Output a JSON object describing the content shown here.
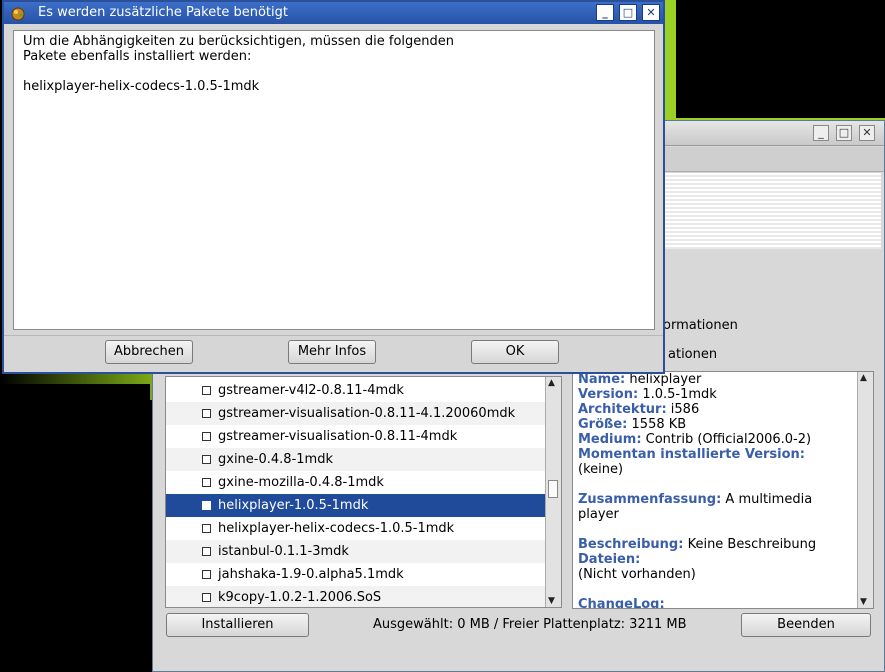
{
  "dialog": {
    "title": "Es werden zusätzliche Pakete benötigt",
    "message": "Um die Abhängigkeiten zu berücksichtigen, müssen die folgenden\nPakete ebenfalls installiert werden:\n\nhelixplayer-helix-codecs-1.0.5-1mdk",
    "buttons": {
      "cancel": "Abbrechen",
      "more_info": "Mehr Infos",
      "ok": "OK"
    },
    "controls": {
      "minimize": "_",
      "maximize": "□",
      "close": "✕"
    }
  },
  "main_window": {
    "controls": {
      "minimize": "_",
      "maximize": "□",
      "close": "✕"
    },
    "partial_labels": {
      "label1": "ormationen",
      "label2": "ationen"
    },
    "packages": [
      {
        "name": "gstreamer-v4l2-0.8.11-4mdk",
        "selected": false
      },
      {
        "name": "gstreamer-visualisation-0.8.11-4.1.20060mdk",
        "selected": false
      },
      {
        "name": "gstreamer-visualisation-0.8.11-4mdk",
        "selected": false
      },
      {
        "name": "gxine-0.4.8-1mdk",
        "selected": false
      },
      {
        "name": "gxine-mozilla-0.4.8-1mdk",
        "selected": false
      },
      {
        "name": "helixplayer-1.0.5-1mdk",
        "selected": true
      },
      {
        "name": "helixplayer-helix-codecs-1.0.5-1mdk",
        "selected": false
      },
      {
        "name": "istanbul-0.1.1-3mdk",
        "selected": false
      },
      {
        "name": "jahshaka-1.9-0.alpha5.1mdk",
        "selected": false
      },
      {
        "name": "k9copy-1.0.2-1.2006.SoS",
        "selected": false
      }
    ],
    "info": {
      "name_label": "Name:",
      "name_value": "helixplayer",
      "version_label": "Version:",
      "version_value": "1.0.5-1mdk",
      "arch_label": "Architektur:",
      "arch_value": "i586",
      "size_label": "Größe:",
      "size_value": "1558 KB",
      "medium_label": "Medium:",
      "medium_value": "Contrib (Official2006.0-2)",
      "installed_label": "Momentan installierte Version:",
      "installed_value": "(keine)",
      "summary_label": "Zusammenfassung:",
      "summary_value": "A multimedia",
      "summary_value2": "player",
      "desc_label": "Beschreibung:",
      "desc_value": "Keine Beschreibung",
      "files_label": "Dateien:",
      "files_value": "(Nicht vorhanden)",
      "changelog_label": "ChangeLog:"
    },
    "status": "Ausgewählt: 0 MB / Freier Plattenplatz: 3211 MB",
    "buttons": {
      "install": "Installieren",
      "quit": "Beenden"
    }
  }
}
